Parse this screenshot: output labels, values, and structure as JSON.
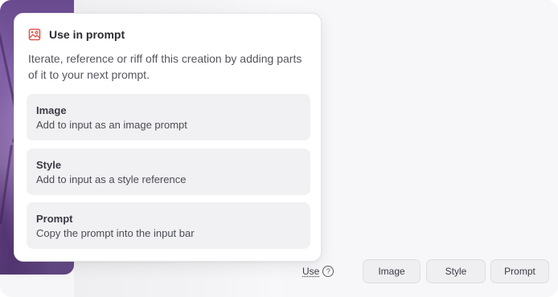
{
  "popover": {
    "title": "Use in prompt",
    "description": "Iterate, reference or riff off this creation by adding parts of it to your next prompt.",
    "options": [
      {
        "title": "Image",
        "subtitle": "Add to input as an image prompt"
      },
      {
        "title": "Style",
        "subtitle": "Add to input as a style reference"
      },
      {
        "title": "Prompt",
        "subtitle": "Copy the prompt into the input bar"
      }
    ]
  },
  "toolbar": {
    "use_label": "Use",
    "help_glyph": "?",
    "buttons": [
      "Image",
      "Style",
      "Prompt"
    ]
  },
  "icons": {
    "header": "image-prompt-icon",
    "help": "question-circle-icon"
  },
  "colors": {
    "accent_icon": "#e2524a",
    "option_bg": "#f1f1f3",
    "card_bg": "#ffffff"
  }
}
